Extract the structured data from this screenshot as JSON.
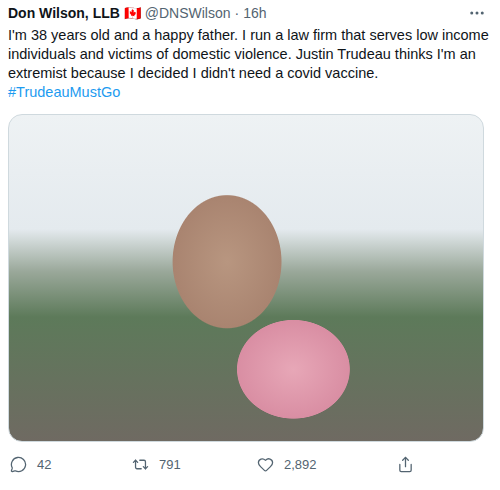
{
  "tweet": {
    "author": {
      "name": "Don Wilson, LLB 🇨🇦",
      "handle": "@DNSWilson",
      "separator": "·",
      "time": "16h"
    },
    "body": [
      {
        "kind": "plain",
        "text": "I'm 38 years old and a happy father. I run a law firm that serves low income individuals and victims of domestic violence. Justin Trudeau thinks I'm an extremist because I decided I didn't need a covid vaccine. "
      },
      {
        "kind": "hashtag",
        "text": "#TrudeauMustGo"
      }
    ],
    "actions": [
      {
        "kind": "reply",
        "count": "42"
      },
      {
        "kind": "retweet",
        "count": "791"
      },
      {
        "kind": "like",
        "count": "2,892"
      },
      {
        "kind": "share"
      }
    ]
  }
}
